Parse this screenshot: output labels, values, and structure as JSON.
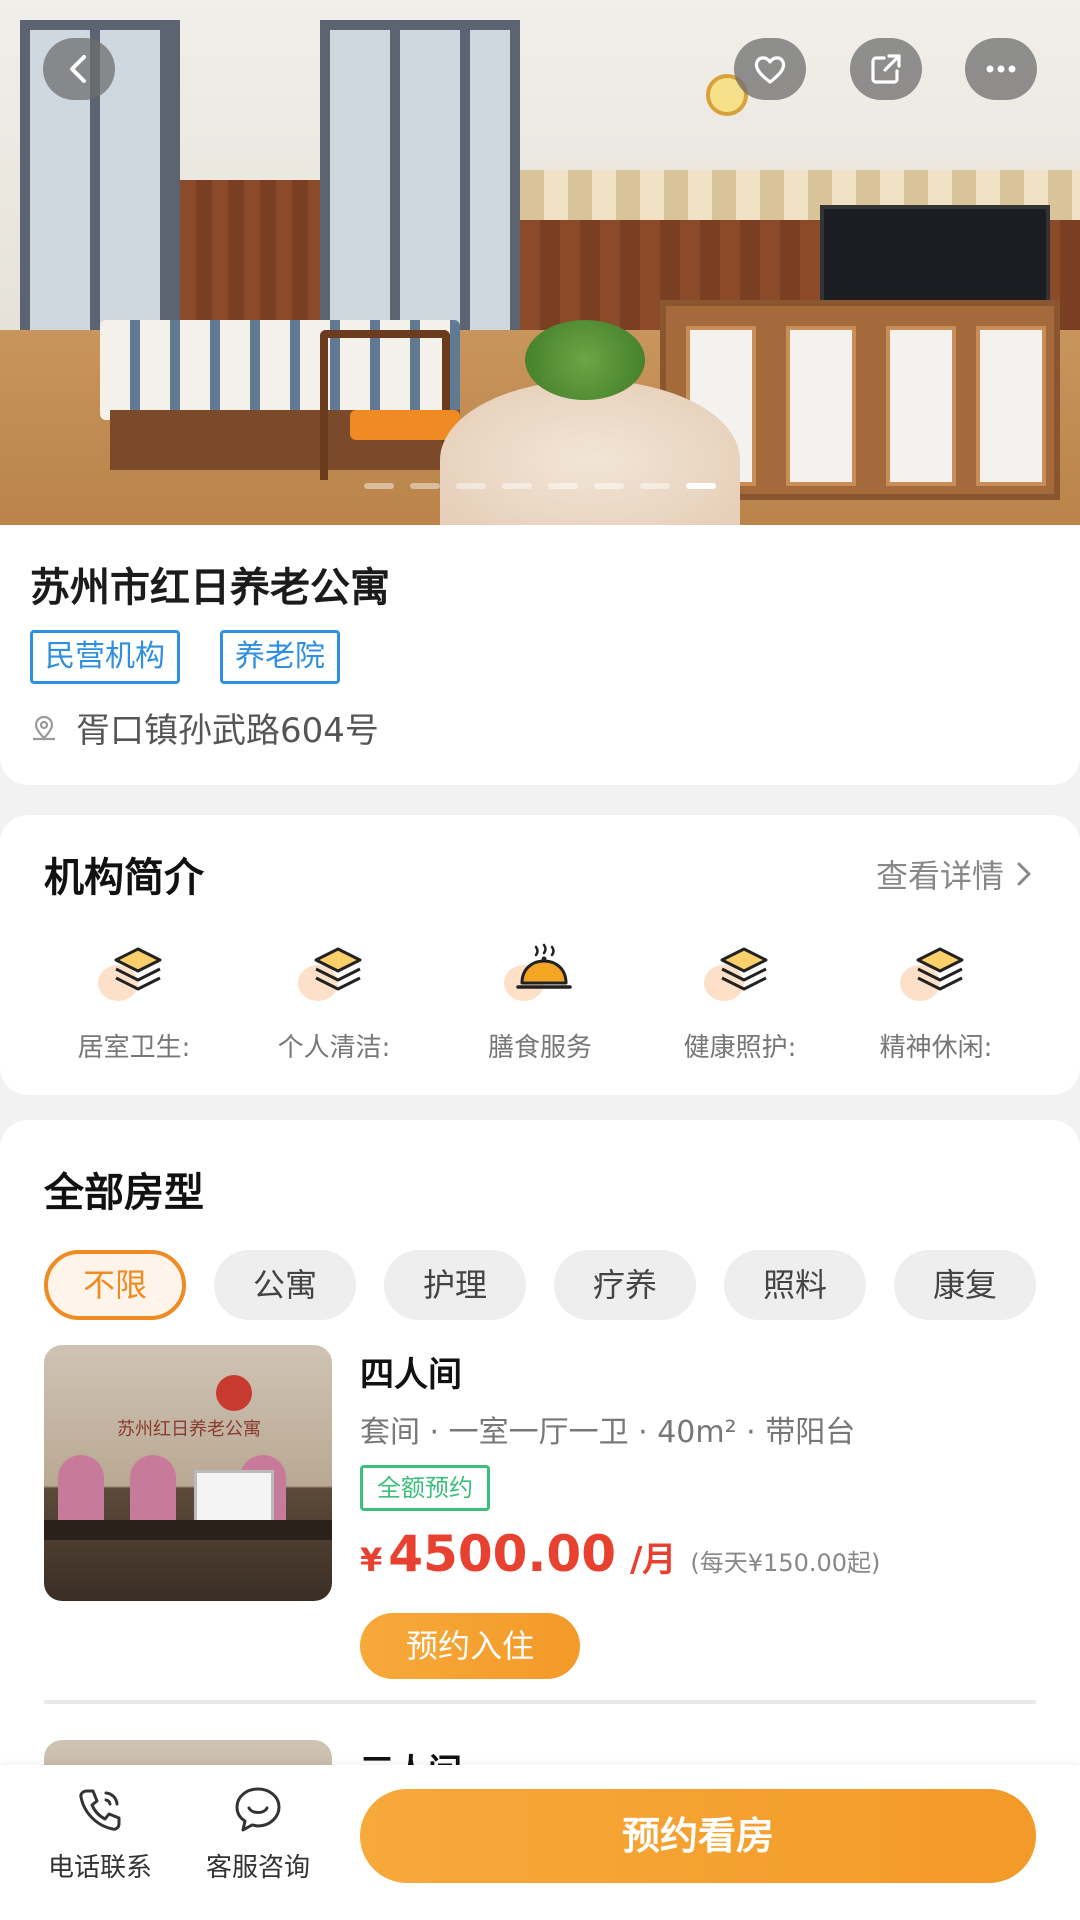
{
  "hero": {
    "slide_count": 8,
    "active_slide": 8
  },
  "info": {
    "title": "苏州市红日养老公寓",
    "tags": [
      "民营机构",
      "养老院"
    ],
    "address": "胥口镇孙武路604号"
  },
  "intro": {
    "title": "机构简介",
    "more": "查看详情",
    "features": [
      {
        "label": "居室卫生:",
        "icon": "stack-icon"
      },
      {
        "label": "个人清洁:",
        "icon": "stack-icon"
      },
      {
        "label": "膳食服务",
        "icon": "food-cloche-icon"
      },
      {
        "label": "健康照护:",
        "icon": "stack-icon"
      },
      {
        "label": "精神休闲:",
        "icon": "stack-icon"
      }
    ]
  },
  "rooms": {
    "title": "全部房型",
    "filters": [
      "不限",
      "公寓",
      "护理",
      "疗养",
      "照料",
      "康复"
    ],
    "active_filter": "不限",
    "items": [
      {
        "name": "四人间",
        "meta": "套间 · 一室一厅一卫 · 40m² · 带阳台",
        "badge": "全额预约",
        "currency": "¥",
        "price": "4500.00",
        "unit": "/月",
        "daily": "(每天¥150.00起)",
        "book": "预约入住",
        "thumb_sign": "苏州红日养老公寓"
      },
      {
        "name": "三人间"
      }
    ]
  },
  "bottom_bar": {
    "phone": "电话联系",
    "service": "客服咨询",
    "cta": "预约看房"
  },
  "colors": {
    "accent_orange": "#f39a28",
    "tag_blue": "#2f8fe0",
    "price_red": "#e8412f",
    "badge_green": "#3bbf7a"
  }
}
